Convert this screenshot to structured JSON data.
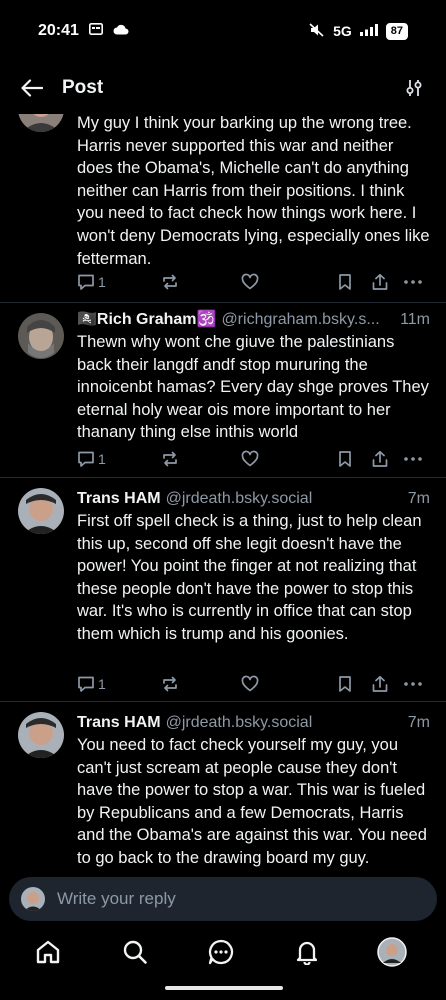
{
  "status": {
    "time": "20:41",
    "network": "5G",
    "battery": "87"
  },
  "header": {
    "title": "Post"
  },
  "posts": [
    {
      "text": "My guy I think your barking up the wrong tree. Harris never supported this war and neither does the Obama's, Michelle can't do anything neither can Harris from their positions. I think you need to fact check how things work here. I won't deny Democrats lying, especially ones like fetterman.",
      "replies": "1"
    },
    {
      "author": "🏴‍☠️Rich Graham🕉️",
      "handle": "@richgraham.bsky.s...",
      "time": "11m",
      "text": "Thewn why wont che giuve the palestinians back their langdf andf stop mururing the innoicenbt hamas? Every day shge proves They eternal holy wear ois more important to her thanany thing else inthis world",
      "replies": "1"
    },
    {
      "author": "Trans HAM",
      "handle": "@jrdeath.bsky.social",
      "time": "7m",
      "text": "First off spell check is a thing, just to help clean this up, second off she legit doesn't have the power! You point the finger at not realizing that these people don't have the power to stop this war. It's who is currently in office that can stop them which is trump and his goonies.",
      "replies": "1"
    },
    {
      "author": "Trans HAM",
      "handle": "@jrdeath.bsky.social",
      "time": "7m",
      "text": "You need to fact check yourself my guy, you can't just scream at people cause they don't have the power to stop a war. This war is fueled by Republicans and a few Democrats, Harris and the Obama's are against this war. You need to go back to the drawing board my guy."
    }
  ],
  "reply_bar": {
    "placeholder": "Write your reply"
  },
  "colors": {
    "background": "#000000",
    "text": "#f1f3f5",
    "muted": "#8d99a6",
    "reply_bg": "#1e252e"
  }
}
